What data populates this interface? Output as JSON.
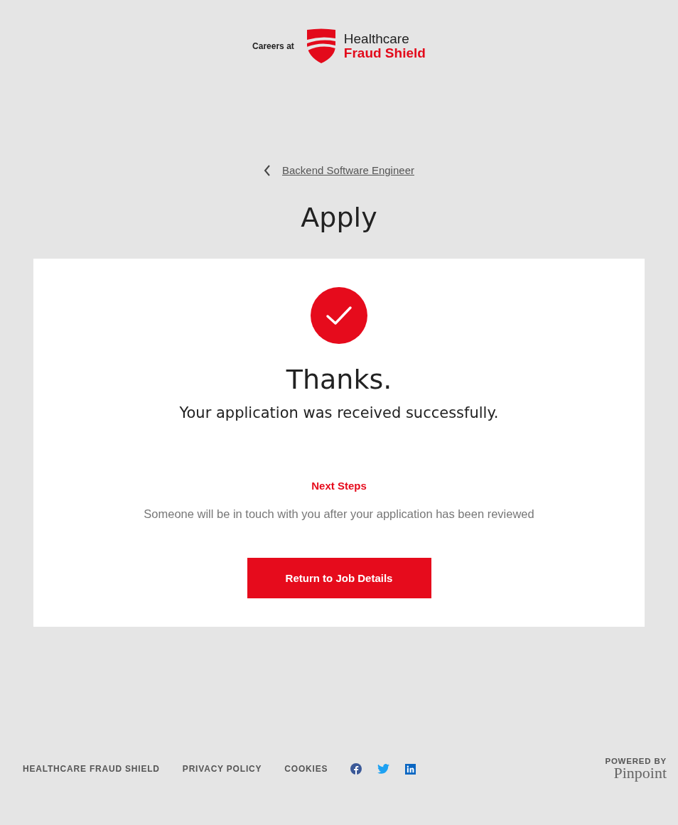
{
  "header": {
    "prefix": "Careers at",
    "logo_line_1": "Healthcare",
    "logo_line_2": "Fraud Shield"
  },
  "back_link": {
    "label": "Backend Software Engineer"
  },
  "title": "Apply",
  "confirmation": {
    "heading": "Thanks.",
    "message": "Your application was received successfully.",
    "next_steps_heading": "Next Steps",
    "next_steps_text": "Someone will be in touch with you after your application has been reviewed",
    "button": "Return to Job Details"
  },
  "footer": {
    "links": [
      "HEALTHCARE FRAUD SHIELD",
      "PRIVACY POLICY",
      "COOKIES"
    ],
    "social": [
      {
        "kind": "facebook"
      },
      {
        "kind": "twitter"
      },
      {
        "kind": "linkedin"
      }
    ],
    "powered_by": "POWERED BY",
    "brand": "Pinpoint"
  }
}
